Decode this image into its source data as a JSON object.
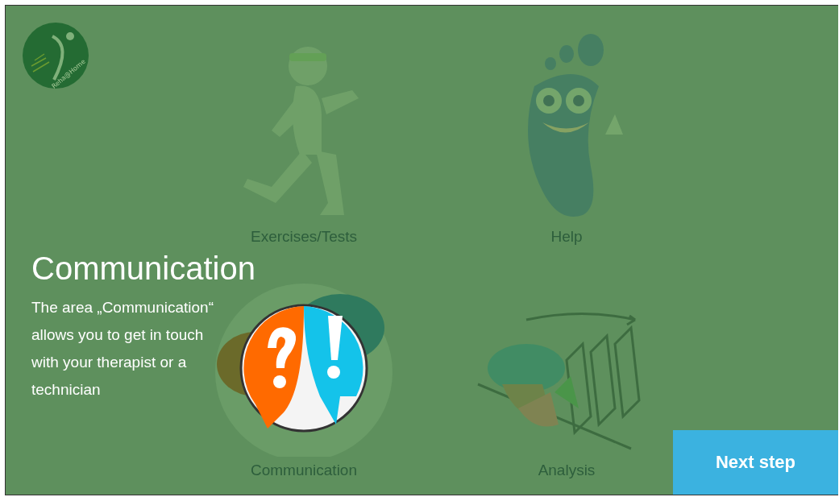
{
  "logo": {
    "text": "Reha@Home"
  },
  "menu": [
    {
      "kind": "exercises",
      "label": "Exercises/Tests",
      "highlighted": false
    },
    {
      "kind": "help",
      "label": "Help",
      "highlighted": false
    },
    {
      "kind": "communication",
      "label": "Communication",
      "highlighted": true
    },
    {
      "kind": "analysis",
      "label": "Analysis",
      "highlighted": false
    }
  ],
  "tutorial": {
    "title": "Communication",
    "description": "The area „Communication“ allows you to get in touch with your therapist or a technician"
  },
  "next_button": {
    "label": "Next step"
  }
}
